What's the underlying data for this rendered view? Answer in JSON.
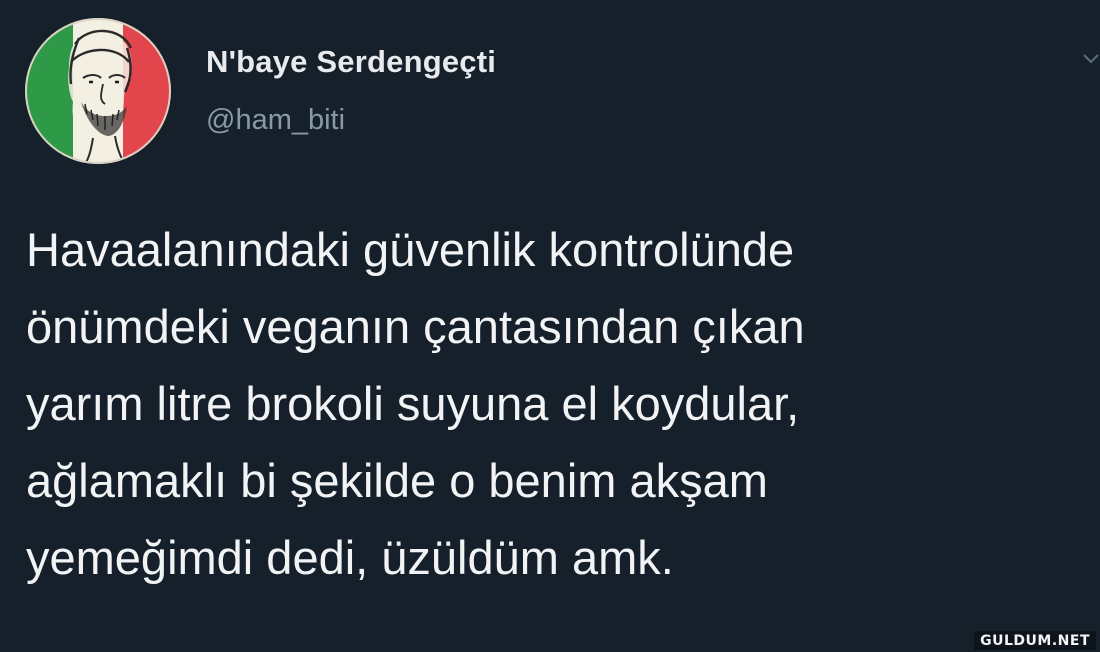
{
  "colors": {
    "background": "#15202b",
    "name_text": "#e8eaed",
    "handle_text": "#8899a6",
    "body_text": "#f2f3f5",
    "avatar_green": "#2e9a48",
    "avatar_white": "#f3efe3",
    "avatar_red": "#e2454b"
  },
  "icons": {
    "avatar": "profile-photo-italian-flag-portrait",
    "caret": "chevron-down-icon"
  },
  "user": {
    "display_name": "N'baye Serdengeçti",
    "handle": "@ham_biti"
  },
  "tweet": {
    "lines": [
      "Havaalanındaki güvenlik kontrolünde",
      "önümdeki veganın çantasından çıkan",
      "yarım litre brokoli suyuna el koydular,",
      "ağlamaklı bi şekilde o benim akşam",
      "yemeğimdi dedi, üzüldüm amk."
    ]
  },
  "watermark": "GULDUM.NET"
}
